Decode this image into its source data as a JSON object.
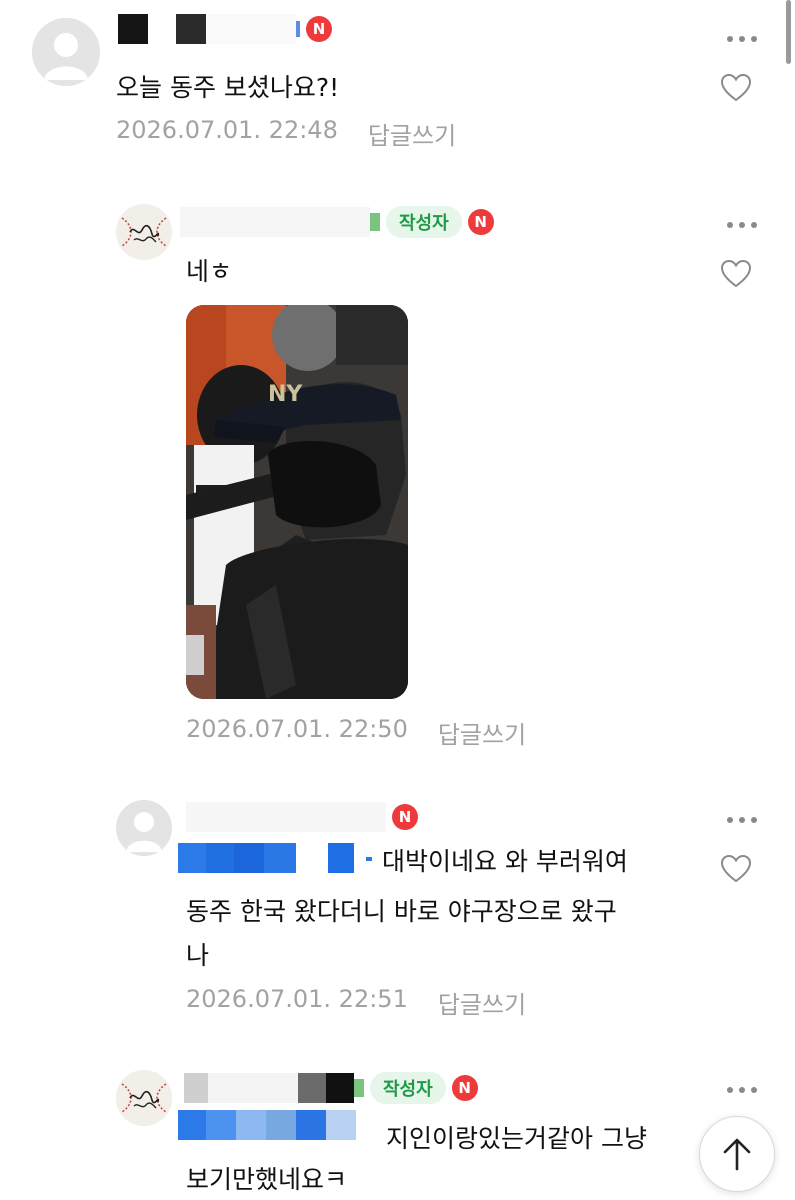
{
  "comments": [
    {
      "text": "오늘 동주 보셨나요?!",
      "date": "2026.07.01. 22:48",
      "reply_label": "답글쓰기",
      "badge": "N"
    },
    {
      "author_badge": "작성자",
      "badge": "N",
      "text": "네ㅎ",
      "date": "2026.07.01. 22:50",
      "reply_label": "답글쓰기"
    },
    {
      "badge": "N",
      "text_line1": "대박이네요 와 부러워여",
      "text_line2": "동주 한국 왔다더니 바로 야구장으로 왔구",
      "text_line3": "나",
      "date": "2026.07.01. 22:51",
      "reply_label": "답글쓰기"
    },
    {
      "author_badge": "작성자",
      "badge": "N",
      "text_line1": "지인이랑있는거같아 그냥",
      "text_line2": "보기만했네요ㅋ"
    }
  ],
  "icons": {
    "more": "more-dots-icon",
    "like": "heart-icon",
    "scroll_top": "arrow-up-icon",
    "avatar_default": "default-profile-icon",
    "avatar_author": "baseball-signature-icon"
  },
  "colors": {
    "new_badge": "#ee3a3a",
    "author_badge_bg": "#e6f6ea",
    "author_badge_text": "#1f9a45",
    "meta_text": "#a2a2a2"
  }
}
